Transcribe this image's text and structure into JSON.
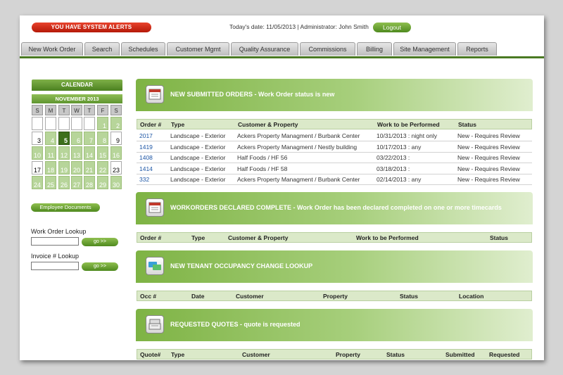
{
  "header": {
    "alert": "YOU HAVE SYSTEM ALERTS",
    "info": "Today's date: 11/05/2013   |   Administrator: John Smith",
    "logout": "Logout"
  },
  "nav": {
    "tabs": [
      "New Work Order",
      "Search",
      "Schedules",
      "Customer Mgmt",
      "Quality Assurance",
      "Commissions",
      "Billing",
      "Site Management",
      "Reports"
    ]
  },
  "sidebar": {
    "calendar_title": "CALENDAR",
    "month": "NOVEMBER 2013",
    "days_of_week": [
      "S",
      "M",
      "T",
      "W",
      "T",
      "F",
      "S"
    ],
    "weeks": [
      [
        "",
        "",
        "",
        "",
        "",
        "1",
        "2"
      ],
      [
        "3",
        "4",
        "5",
        "6",
        "7",
        "8",
        "9"
      ],
      [
        "10",
        "11",
        "12",
        "13",
        "14",
        "15",
        "16"
      ],
      [
        "17",
        "18",
        "19",
        "20",
        "21",
        "22",
        "23"
      ],
      [
        "24",
        "25",
        "26",
        "27",
        "28",
        "29",
        "30"
      ]
    ],
    "employee_docs": "Employee Documents",
    "wo_lookup_label": "Work Order Lookup",
    "invoice_lookup_label": "Invoice # Lookup",
    "go": "go >>"
  },
  "sections": {
    "submitted": {
      "title": "NEW SUBMITTED ORDERS",
      "subtitle": " - Work Order status is new",
      "columns": [
        "Order #",
        "Type",
        "Customer & Property",
        "Work to be Performed",
        "Status"
      ],
      "rows": [
        [
          "2017",
          "Landscape - Exterior",
          "Ackers Property Managment / Burbank Center",
          "10/31/2013 : night only",
          "New - Requires Review"
        ],
        [
          "1419",
          "Landscape - Exterior",
          "Ackers Property Managment / Nestly building",
          "10/17/2013 : any",
          "New - Requires Review"
        ],
        [
          "1408",
          "Landscape - Exterior",
          "Half Foods / HF 56",
          "03/22/2013 :",
          "New - Requires Review"
        ],
        [
          "1414",
          "Landscape - Exterior",
          "Half Foods / HF 58",
          "03/18/2013 :",
          "New - Requires Review"
        ],
        [
          "332",
          "Landscape - Exterior",
          "Ackers Property Managment / Burbank Center",
          "02/14/2013 : any",
          "New - Requires Review"
        ]
      ]
    },
    "declared": {
      "title": "WORKORDERS DECLARED COMPLETE",
      "subtitle": " - Work Order has been declared completed on one or more timecards",
      "columns": [
        "Order #",
        "Type",
        "Customer & Property",
        "Work to be Performed",
        "Status"
      ]
    },
    "tenant": {
      "title": "NEW TENANT OCCUPANCY CHANGE LOOKUP",
      "subtitle": "",
      "columns": [
        "Occ #",
        "Date",
        "Customer",
        "Property",
        "Status",
        "Location"
      ]
    },
    "quotes": {
      "title": "REQUESTED QUOTES",
      "subtitle": " - quote is requested",
      "columns": [
        "Quote#",
        "Type",
        "Customer",
        "Property",
        "Status",
        "Submitted",
        "Requested"
      ]
    }
  }
}
